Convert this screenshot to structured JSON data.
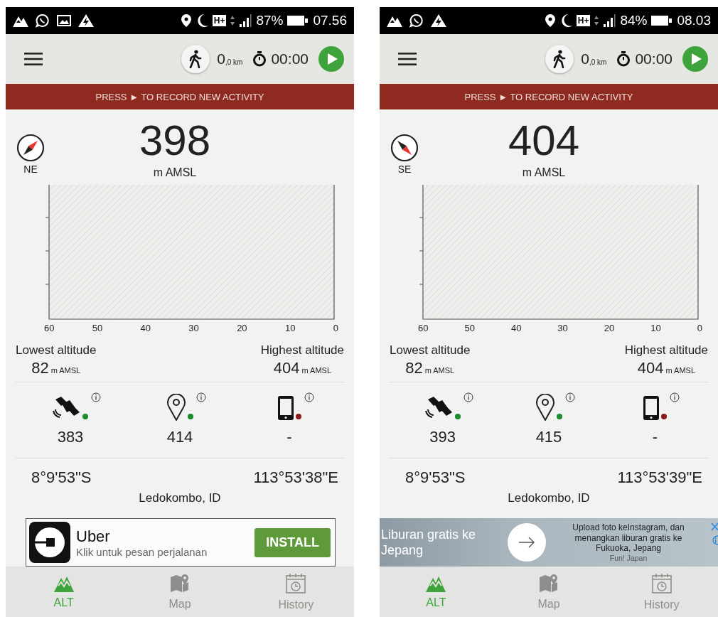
{
  "phones": [
    {
      "status_bar": {
        "notification_icons": [
          {
            "kind": "mountain"
          },
          {
            "kind": "chat"
          },
          {
            "kind": "image"
          },
          {
            "kind": "bolt"
          }
        ],
        "network": "H+",
        "battery": "87%",
        "time": "07.56"
      },
      "toolbar": {
        "distance": "0",
        "distance_unit": ",0 km",
        "timer": "00:00"
      },
      "banner": "PRESS ► TO RECORD NEW ACTIVITY",
      "compass": {
        "label": "NE",
        "kind": "northeast"
      },
      "altitude": {
        "value": "398",
        "unit": "m AMSL"
      },
      "chart_axis_labels": [
        "60",
        "50",
        "40",
        "30",
        "20",
        "10",
        "0"
      ],
      "lowest": {
        "label": "Lowest altitude",
        "value": "82",
        "unit": "m AMSL"
      },
      "highest": {
        "label": "Highest altitude",
        "value": "404",
        "unit": "m AMSL"
      },
      "sensors": [
        {
          "kind": "satellite",
          "value": "383",
          "color": "#1a8a2a"
        },
        {
          "kind": "pin",
          "value": "414",
          "color": "#1a8a2a"
        },
        {
          "kind": "phone",
          "value": "-",
          "color": "#8b1a1a"
        }
      ],
      "latitude": "8°9'53\"S",
      "longitude": "113°53'38\"E",
      "place": "Ledokombo, ID",
      "ad": {
        "kind": "app_install",
        "title": "Uber",
        "subtitle": "Klik untuk pesan perjalanan",
        "button": "INSTALL"
      },
      "tabs": [
        {
          "kind": "altitude",
          "label": "ALT",
          "selected": true
        },
        {
          "kind": "map",
          "label": "Map",
          "selected": false
        },
        {
          "kind": "history",
          "label": "History",
          "selected": false
        }
      ]
    },
    {
      "status_bar": {
        "notification_icons": [
          {
            "kind": "mountain"
          },
          {
            "kind": "chat"
          },
          {
            "kind": "bolt"
          }
        ],
        "network": "H+",
        "battery": "84%",
        "time": "08.03"
      },
      "toolbar": {
        "distance": "0",
        "distance_unit": ",0 km",
        "timer": "00:00"
      },
      "banner": "PRESS ► TO RECORD NEW ACTIVITY",
      "compass": {
        "label": "SE",
        "kind": "southeast"
      },
      "altitude": {
        "value": "404",
        "unit": "m AMSL"
      },
      "chart_axis_labels": [
        "60",
        "50",
        "40",
        "30",
        "20",
        "10",
        "0"
      ],
      "lowest": {
        "label": "Lowest altitude",
        "value": "82",
        "unit": "m AMSL"
      },
      "highest": {
        "label": "Highest altitude",
        "value": "404",
        "unit": "m AMSL"
      },
      "sensors": [
        {
          "kind": "satellite",
          "value": "393",
          "color": "#1a8a2a"
        },
        {
          "kind": "pin",
          "value": "415",
          "color": "#1a8a2a"
        },
        {
          "kind": "phone",
          "value": "-",
          "color": "#8b1a1a"
        }
      ],
      "latitude": "8°9'53\"S",
      "longitude": "113°53'39\"E",
      "place": "Ledokombo, ID",
      "ad": {
        "kind": "banner",
        "headline": "Liburan gratis ke Jepang",
        "description": "Upload foto keInstagram, dan menangkan liburan gratis ke Fukuoka, Jepang",
        "sponsor": "Fun! Japan"
      },
      "tabs": [
        {
          "kind": "altitude",
          "label": "ALT",
          "selected": true
        },
        {
          "kind": "map",
          "label": "Map",
          "selected": false
        },
        {
          "kind": "history",
          "label": "History",
          "selected": false
        }
      ]
    }
  ]
}
